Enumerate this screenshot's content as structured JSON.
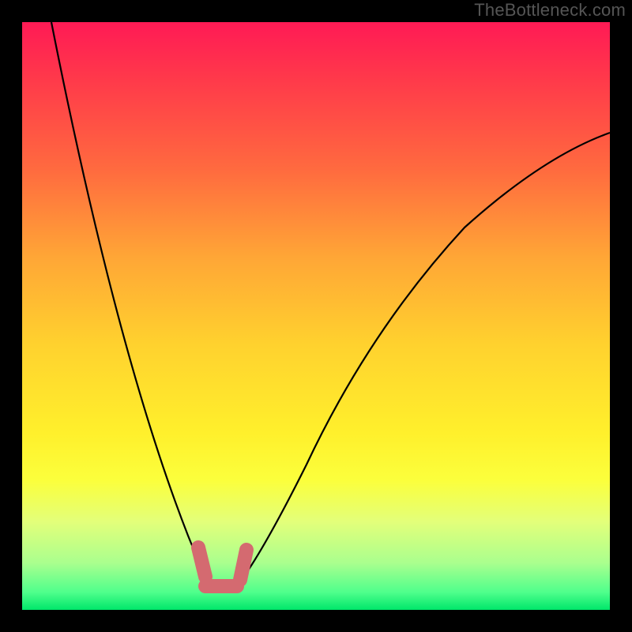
{
  "watermark": "TheBottleneck.com",
  "chart_data": {
    "type": "line",
    "title": "",
    "xlabel": "",
    "ylabel": "",
    "xlim": [
      0,
      100
    ],
    "ylim": [
      0,
      100
    ],
    "grid": false,
    "legend": false,
    "background_gradient": [
      "#ff1a55",
      "#ff3a4a",
      "#ff6a3f",
      "#ffa636",
      "#ffd22e",
      "#fff02c",
      "#fbff3c",
      "#e3ff7a",
      "#aaff8e",
      "#4fff8c",
      "#00e66a"
    ],
    "series": [
      {
        "name": "curve",
        "color": "#000000",
        "x": [
          5,
          10,
          15,
          20,
          23,
          26,
          28,
          30,
          32,
          33,
          37,
          40,
          45,
          50,
          55,
          60,
          65,
          70,
          75,
          80,
          85,
          90,
          95,
          100
        ],
        "y": [
          100,
          81,
          62,
          43,
          30,
          18,
          10,
          4,
          1,
          0,
          0,
          4,
          14,
          25,
          34,
          42,
          49,
          55,
          60,
          65,
          69,
          73,
          76,
          79
        ]
      }
    ],
    "marker_segment": {
      "name": "highlighted-range",
      "color": "#d86a6a",
      "x_range": [
        30,
        37
      ],
      "style": "thick-rounded"
    }
  }
}
